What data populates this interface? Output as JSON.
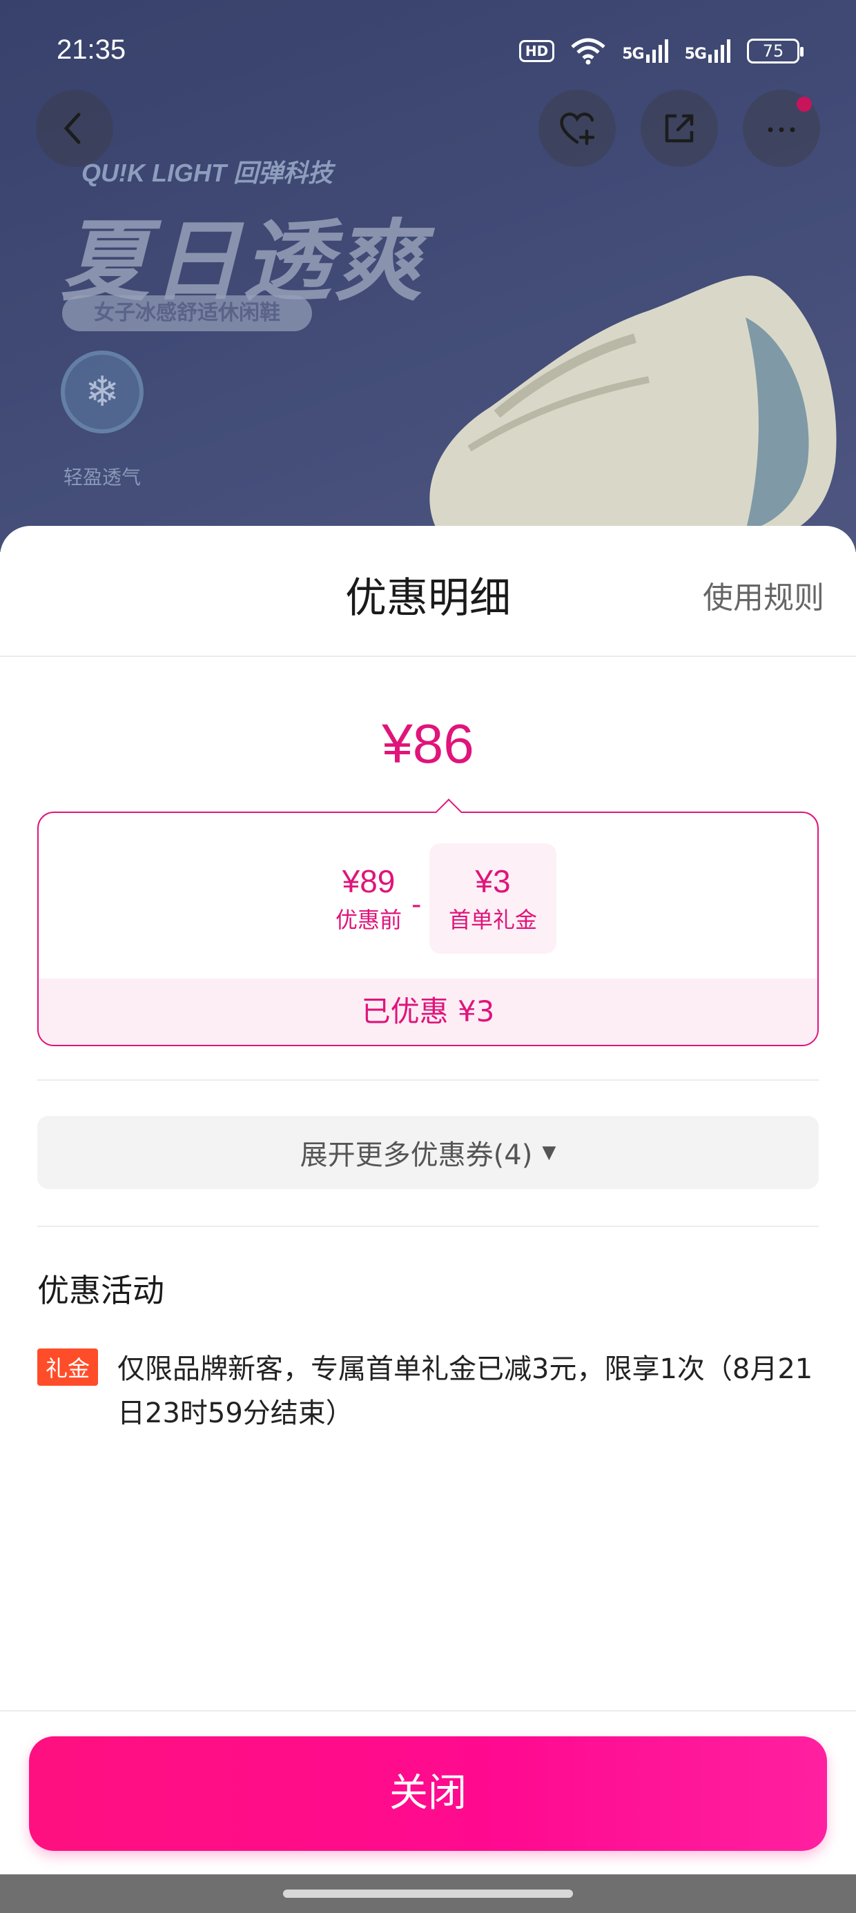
{
  "status_bar": {
    "time": "21:35",
    "hd_label": "HD",
    "signal_1": "5G",
    "signal_2": "5G",
    "battery": "75"
  },
  "banner": {
    "brand_line": "QU!K LIGHT 回弹科技",
    "headline": "夏日透爽",
    "pill": "女子冰感舒适休闲鞋",
    "badge_label": "轻盈透气"
  },
  "sheet": {
    "title": "优惠明细",
    "rules_link": "使用规则",
    "final_price": "¥86",
    "breakdown": {
      "original_amount": "¥89",
      "original_label": "优惠前",
      "minus": "-",
      "coupon_amount": "¥3",
      "coupon_label": "首单礼金",
      "saved": "已优惠 ¥3"
    },
    "expand_label": "展开更多优惠券(4)",
    "section_title": "优惠活动",
    "activity": {
      "tag": "礼金",
      "text": "仅限品牌新客，专属首单礼金已减3元，限享1次（8月21日23时59分结束）"
    },
    "close_label": "关闭"
  },
  "colors": {
    "accent": "#e0147a",
    "tag": "#ff4d2a"
  }
}
